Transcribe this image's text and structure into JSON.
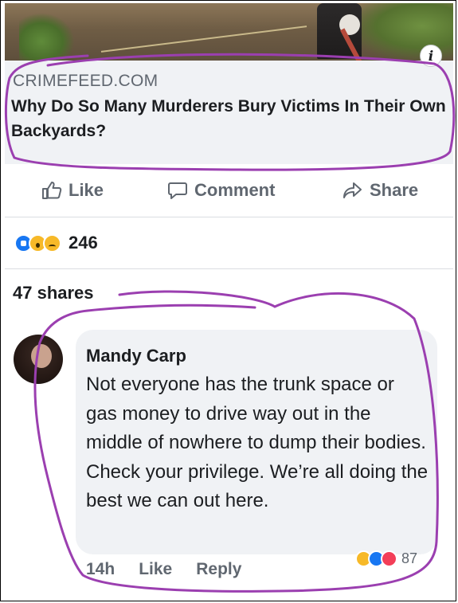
{
  "link_preview": {
    "source": "CRIMEFEED.COM",
    "headline": "Why Do So Many Murderers Bury Victims In Their Own Backyards?",
    "info_icon": "info-icon"
  },
  "actions": {
    "like": "Like",
    "comment": "Comment",
    "share": "Share"
  },
  "reactions": {
    "icons": [
      "like-icon",
      "wow-icon",
      "sad-icon"
    ],
    "count": "246"
  },
  "shares": "47 shares",
  "comment": {
    "author": "Mandy Carp",
    "text": "Not everyone has the trunk space or gas money to drive way out in the middle of nowhere to dump their bodies. Check your privilege. We’re all doing the best we can out here.",
    "time": "14h",
    "like": "Like",
    "reply": "Reply",
    "reactions": [
      "haha-icon",
      "like-icon",
      "love-icon"
    ],
    "reaction_count": "87"
  },
  "colors": {
    "facebook_blue": "#1877f2",
    "annotation_purple": "#9b3fb0",
    "bubble_gray": "#f0f2f5"
  }
}
